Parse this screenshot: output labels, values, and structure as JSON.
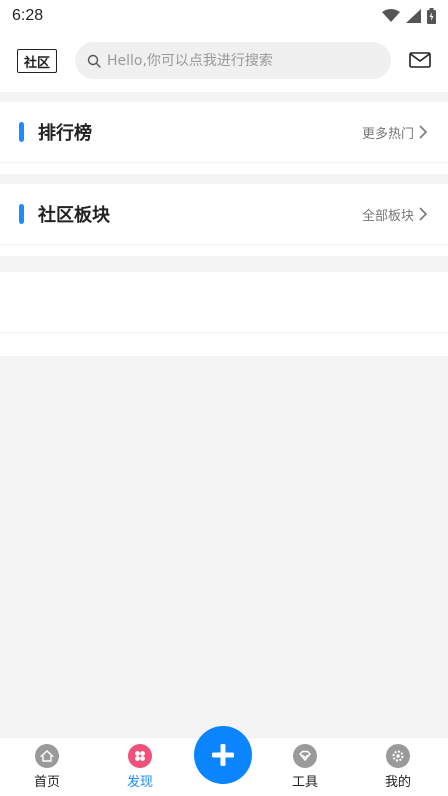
{
  "status_bar": {
    "time": "6:28"
  },
  "header": {
    "logo_text": "社区",
    "search_placeholder": "Hello,你可以点我进行搜索"
  },
  "sections": [
    {
      "title": "排行榜",
      "more": "更多热门"
    },
    {
      "title": "社区板块",
      "more": "全部板块"
    }
  ],
  "bottom_nav": {
    "home": "首页",
    "discover": "发现",
    "tools": "工具",
    "mine": "我的"
  },
  "colors": {
    "accent": "#1a8cff",
    "fab": "#0a84ff",
    "discover_icon": "#f0507a"
  }
}
